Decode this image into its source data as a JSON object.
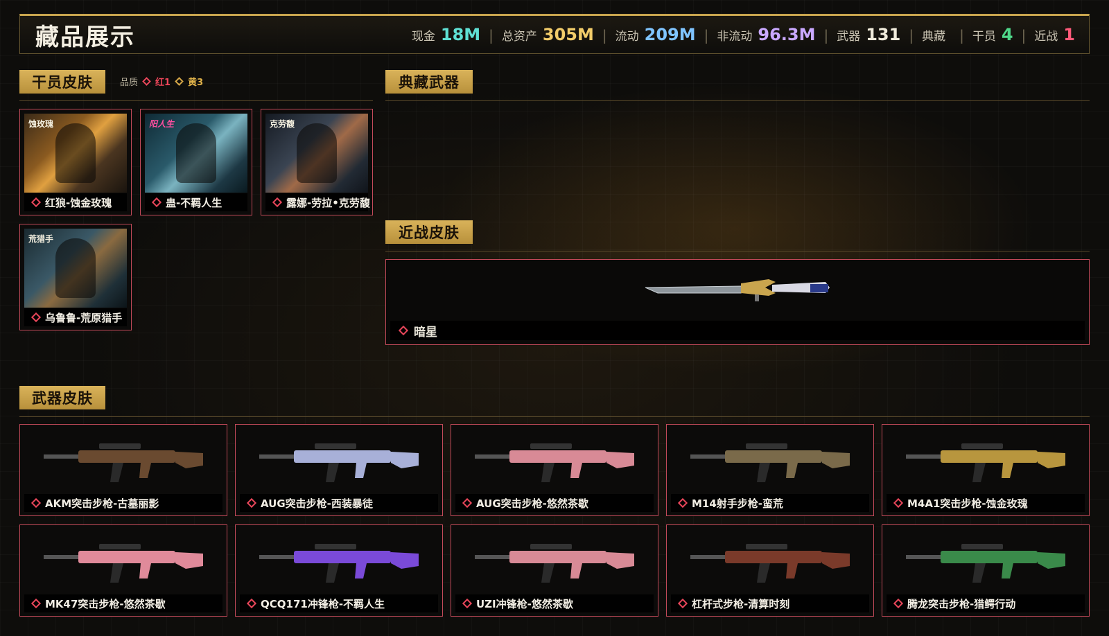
{
  "header": {
    "title": "藏品展示",
    "stats": [
      {
        "label": "现金",
        "value": "18M",
        "color": "#5fe0d4"
      },
      {
        "label": "总资产",
        "value": "305M",
        "color": "#f2cc6a"
      },
      {
        "label": "流动",
        "value": "209M",
        "color": "#7fc4ff"
      },
      {
        "label": "非流动",
        "value": "96.3M",
        "color": "#c9a8ff"
      },
      {
        "label": "武器",
        "value": "131",
        "color": "#f1ecdc"
      },
      {
        "label": "典藏",
        "value": "",
        "color": "#f1ecdc"
      },
      {
        "label": "干员",
        "value": "4",
        "color": "#4fd88a"
      },
      {
        "label": "近战",
        "value": "1",
        "color": "#ff5a7a"
      }
    ]
  },
  "operator_section": {
    "title": "干员皮肤",
    "quality_label": "品质",
    "quality_red": "红1",
    "quality_yellow": "黄3",
    "items": [
      {
        "name": "红狼-蚀金玫瑰",
        "logo": "蚀玫瑰"
      },
      {
        "name": "蛊-不羁人生",
        "logo": "阳人生"
      },
      {
        "name": "露娜-劳拉•克劳馥",
        "logo": "克劳馥"
      },
      {
        "name": "乌鲁鲁-荒原猎手",
        "logo": "荒猎手"
      }
    ]
  },
  "collection_section": {
    "title": "典藏武器"
  },
  "melee_section": {
    "title": "近战皮肤",
    "item": "暗星"
  },
  "weapon_section": {
    "title": "武器皮肤",
    "items": [
      {
        "name": "AKM突击步枪-古墓丽影",
        "color": "#6a4a30"
      },
      {
        "name": "AUG突击步枪-西装暴徒",
        "color": "#a8b0d8"
      },
      {
        "name": "AUG突击步枪-悠然茶歇",
        "color": "#d88a96"
      },
      {
        "name": "M14射手步枪-蛮荒",
        "color": "#7a6a4a"
      },
      {
        "name": "M4A1突击步枪-蚀金玫瑰",
        "color": "#b8963e"
      },
      {
        "name": "MK47突击步枪-悠然茶歇",
        "color": "#e08a9a"
      },
      {
        "name": "QCQ171冲锋枪-不羁人生",
        "color": "#7a4ad8"
      },
      {
        "name": "UZI冲锋枪-悠然茶歇",
        "color": "#d88a96"
      },
      {
        "name": "杠杆式步枪-清算时刻",
        "color": "#7a3a2a"
      },
      {
        "name": "腾龙突击步枪-猎鳄行动",
        "color": "#3a8a4a"
      }
    ]
  }
}
